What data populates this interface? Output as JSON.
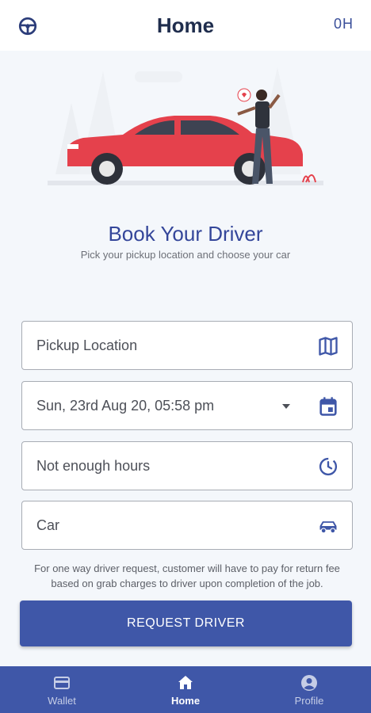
{
  "header": {
    "title": "Home",
    "right_text": "0H",
    "left_icon": "steering-wheel-icon"
  },
  "hero": {
    "title": "Book Your Driver",
    "subtitle": "Pick your pickup location and choose your car"
  },
  "form": {
    "pickup": {
      "label": "Pickup Location",
      "icon": "map-icon"
    },
    "datetime": {
      "label": "Sun, 23rd Aug 20, 05:58 pm",
      "icon": "calendar-icon"
    },
    "hours": {
      "label": "Not enough hours",
      "icon": "clock-icon"
    },
    "car": {
      "label": "Car",
      "icon": "car-icon"
    }
  },
  "note": "For one way driver request, customer will have to pay for return fee based on grab charges to driver upon completion of the job.",
  "cta": {
    "label": "REQUEST DRIVER"
  },
  "nav": {
    "items": [
      {
        "label": "Wallet",
        "icon": "wallet-icon",
        "active": false
      },
      {
        "label": "Home",
        "icon": "home-icon",
        "active": true
      },
      {
        "label": "Profile",
        "icon": "profile-icon",
        "active": false
      }
    ]
  },
  "colors": {
    "primary": "#3f57a8",
    "heading": "#34469a",
    "car_red": "#e5414c",
    "background": "#f4f7fb"
  }
}
